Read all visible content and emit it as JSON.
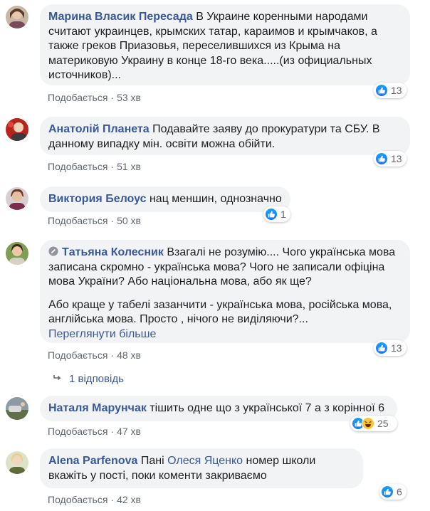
{
  "comments": [
    {
      "author": "Марина Власик Пересада",
      "text": "В Украине коренными народами считают украинцев, крымских татар, караимов и крымчаков, а также греков Приазовья, переселившихся из Крыма на материковую Украину в конце 18-го века.....(из официальных источников)...",
      "like_label": "Подобається",
      "time": "53 хв",
      "reaction_count": "13"
    },
    {
      "author": "Анатолій Планета",
      "text": "Подавайте заяву до прокуратури та СБУ. В данному випадку мін. освіти можна обійти.",
      "like_label": "Подобається",
      "time": "51 хв",
      "reaction_count": "13"
    },
    {
      "author": "Виктория Белоус",
      "text": "нац меншин, однозначно",
      "like_label": "Подобається",
      "time": "50 хв",
      "reaction_count": "1"
    },
    {
      "author": "Тaтьяна Колесник",
      "text": "Взагалі не розумію.... Чого українська мова записана скромно - українська мова? Чого не записали офіціна мова України? Або національна мова, або як ще?",
      "text2": "Або краще у табелі зазанчити - українська мова, російська мова, англійська мова. Просто , нічого не виділяючи?...",
      "see_more": "Переглянути більше",
      "like_label": "Подобається",
      "time": "48 хв",
      "reaction_count": "13",
      "replies_label": "1 відповідь"
    },
    {
      "author": "Наталя Марунчак",
      "text": "тішить одне що з української 7 а з корінної 6",
      "like_label": "Подобається",
      "time": "47 хв",
      "reaction_count": "25"
    },
    {
      "author": "Alena Parfenova",
      "text_before": "Пані",
      "mention": "Олеся Яценко",
      "text_after": "номер школи вкажіть у пості, поки коменти закриваємо",
      "like_label": "Подобається",
      "time": "42 хв",
      "reaction_count": "6"
    }
  ],
  "colors": {
    "link": "#385898",
    "bubble": "#f2f3f5",
    "like_blue": "#1877f2",
    "meta": "#606770"
  }
}
